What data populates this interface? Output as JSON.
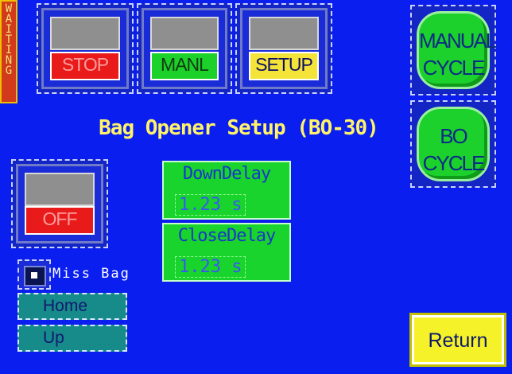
{
  "status": {
    "text": "WAITING"
  },
  "mode_buttons": [
    {
      "label": "STOP"
    },
    {
      "label": "MANL"
    },
    {
      "label": "SETUP"
    }
  ],
  "title": "Bag Opener Setup (BO-30)",
  "cycle_buttons": {
    "manual": {
      "line1": "MANUAL",
      "line2": "CYCLE"
    },
    "bo": {
      "line1": "BO",
      "line2": "CYCLE"
    }
  },
  "toggle": {
    "label": "OFF"
  },
  "settings": [
    {
      "label": "DownDelay",
      "value": "1.23 s"
    },
    {
      "label": "CloseDelay",
      "value": "1.23 s"
    }
  ],
  "miss_bag": {
    "label": "Miss Bag",
    "checked": true
  },
  "nav_buttons": [
    {
      "label": "Home"
    },
    {
      "label": "Up"
    }
  ],
  "return_button": {
    "label": "Return"
  },
  "colors": {
    "background": "#0a1ef0",
    "stop": "#e81a1a",
    "manual": "#1bd12a",
    "setup": "#f4e43a",
    "status": "#d13a1a"
  }
}
